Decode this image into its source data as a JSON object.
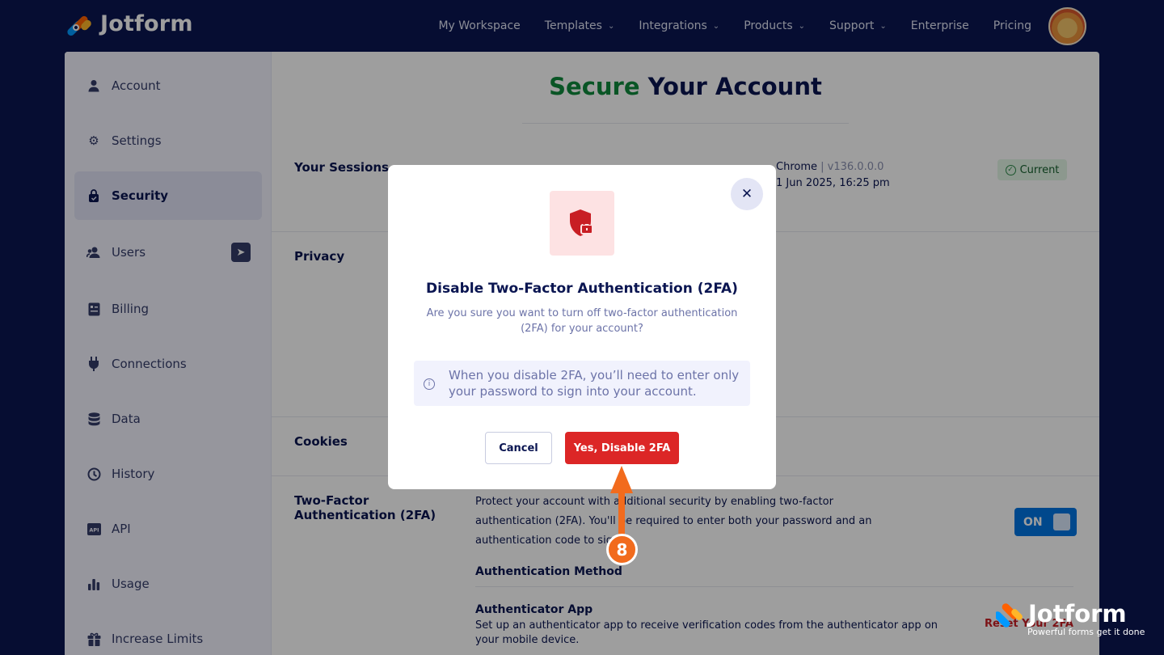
{
  "brand": {
    "name": "Jotform"
  },
  "nav": {
    "items": [
      {
        "label": "My Workspace",
        "dropdown": false
      },
      {
        "label": "Templates",
        "dropdown": true
      },
      {
        "label": "Integrations",
        "dropdown": true
      },
      {
        "label": "Products",
        "dropdown": true
      },
      {
        "label": "Support",
        "dropdown": true
      },
      {
        "label": "Enterprise",
        "dropdown": false
      },
      {
        "label": "Pricing",
        "dropdown": false
      }
    ]
  },
  "sidebar": {
    "items": [
      {
        "label": "Account",
        "icon": "user-icon"
      },
      {
        "label": "Settings",
        "icon": "gear-icon"
      },
      {
        "label": "Security",
        "icon": "lock-bag-icon",
        "active": true
      },
      {
        "label": "Users",
        "icon": "users-icon"
      },
      {
        "label": "Billing",
        "icon": "billing-icon"
      },
      {
        "label": "Connections",
        "icon": "plug-icon"
      },
      {
        "label": "Data",
        "icon": "database-icon"
      },
      {
        "label": "History",
        "icon": "history-icon"
      },
      {
        "label": "API",
        "icon": "api-icon"
      },
      {
        "label": "Usage",
        "icon": "bar-chart-icon"
      },
      {
        "label": "Increase Limits",
        "icon": "gift-icon"
      }
    ]
  },
  "page": {
    "title_accent": "Secure",
    "title_rest": " Your Account",
    "sessions": {
      "label": "Your Sessions",
      "browser": "Chrome",
      "sep": " | ",
      "version": "v136.0.0.0",
      "date": "1 Jun 2025, 16:25 pm",
      "badge": "Current"
    },
    "privacy_label": "Privacy",
    "cookies_label": "Cookies",
    "twofa": {
      "label": "Two-Factor Authentication (2FA)",
      "description": "Protect your account with additional security by enabling two-factor authentication (2FA). You'll be required to enter both your password and an authentication code to sign",
      "toggle": "ON",
      "methods_heading": "Authentication Method",
      "app_heading": "Authenticator App",
      "app_desc": "Set up an authenticator app to receive verification codes from the authenticator app on your mobile device.",
      "reset_link": "Reset Your 2FA"
    }
  },
  "modal": {
    "title": "Disable Two-Factor Authentication (2FA)",
    "subtitle": "Are you sure you want to turn off two-factor authentication (2FA) for your account?",
    "info": "When you disable 2FA, you’ll need to enter only your password to sign into your account.",
    "cancel_label": "Cancel",
    "confirm_label": "Yes, Disable 2FA"
  },
  "annotation": {
    "step": "8"
  },
  "watermark": {
    "name": "Jotform",
    "tagline": "Powerful forms get it done"
  },
  "colors": {
    "navy": "#0a1551",
    "accent_green": "#0f8a3c",
    "danger": "#dc2626",
    "toggle_on": "#0075e3",
    "annotation": "#f26b1d"
  }
}
